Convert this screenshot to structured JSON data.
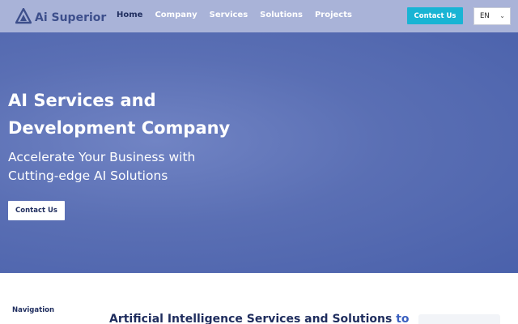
{
  "header": {
    "logo_text": "Ai Superior",
    "nav": [
      {
        "label": "Home",
        "active": true
      },
      {
        "label": "Company",
        "active": false
      },
      {
        "label": "Services",
        "active": false
      },
      {
        "label": "Solutions",
        "active": false
      },
      {
        "label": "Projects",
        "active": false
      }
    ],
    "contact_label": "Contact Us",
    "language": "EN",
    "icons": {
      "logo": "triangle-logo-icon",
      "lang_dropdown": "chevron-down-icon"
    }
  },
  "hero": {
    "title_line1": "AI Services and",
    "title_line2": "Development Company",
    "subtitle_line1": "Accelerate Your Business with",
    "subtitle_line2": "Cutting-edge AI Solutions",
    "cta_label": "Contact Us"
  },
  "content": {
    "nav_label": "Navigation",
    "section_title": "Artificial Intelligence Services and Solutions",
    "section_title_accent": "to"
  },
  "colors": {
    "header_bg": "#a9b3d8",
    "hero_bg": "#5a6fb4",
    "accent_button": "#19b4d4",
    "brand_dark": "#1f2d5e"
  }
}
